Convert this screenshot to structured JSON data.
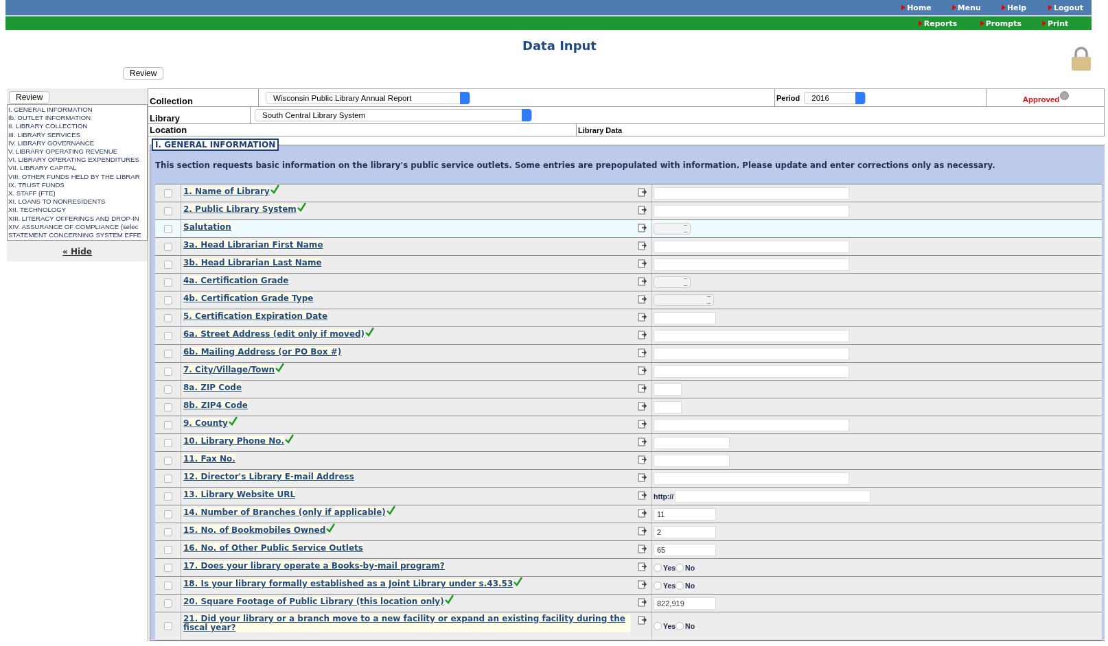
{
  "top_nav": [
    {
      "label": "Home"
    },
    {
      "label": "Menu"
    },
    {
      "label": "Help"
    },
    {
      "label": "Logout"
    }
  ],
  "sub_nav": [
    {
      "label": "Reports"
    },
    {
      "label": "Prompts"
    },
    {
      "label": "Print"
    }
  ],
  "page_title": "Data Input",
  "review_button": "Review",
  "sidebar": {
    "review_button": "Review",
    "items": [
      {
        "label": "I. GENERAL INFORMATION"
      },
      {
        "label": "Ib. OUTLET INFORMATION"
      },
      {
        "label": "II. LIBRARY COLLECTION"
      },
      {
        "label": "III. LIBRARY SERVICES"
      },
      {
        "label": "IV. LIBRARY GOVERNANCE"
      },
      {
        "label": "V. LIBRARY OPERATING REVENUE"
      },
      {
        "label": "VI. LIBRARY OPERATING EXPENDITURES"
      },
      {
        "label": "VII. LIBRARY CAPITAL"
      },
      {
        "label": "VIII. OTHER FUNDS HELD BY THE LIBRAR"
      },
      {
        "label": "IX. TRUST FUNDS"
      },
      {
        "label": "X. STAFF (FTE)"
      },
      {
        "label": "XI. LOANS TO NONRESIDENTS"
      },
      {
        "label": "XII. TECHNOLOGY"
      },
      {
        "label": "XIII. LITERACY OFFERINGS AND DROP-IN"
      },
      {
        "label": "XIV. ASSURANCE OF COMPLIANCE (selec"
      },
      {
        "label": "STATEMENT CONCERNING SYSTEM EFFE"
      }
    ],
    "hide_link": "« Hide"
  },
  "header": {
    "collection_label": "Collection",
    "collection_value": "Wisconsin Public Library Annual Report",
    "period_label": "Period",
    "period_value": "2016",
    "status": "Approved",
    "library_label": "Library",
    "library_value": "South Central Library System",
    "location_label": "Location",
    "library_data_label": "Library Data"
  },
  "section": {
    "title": "I. GENERAL INFORMATION",
    "description": "This section requests basic information on the library's public service outlets. Some entries are prepopulated with information. Please update and enter corrections only as necessary.",
    "rows": [
      {
        "label": "1. Name of Library",
        "verified": true,
        "checked": false,
        "highlighted": false,
        "kind": "long-text"
      },
      {
        "label": "2. Public Library System",
        "verified": true,
        "checked": false,
        "highlighted": false,
        "kind": "long-text"
      },
      {
        "label": "Salutation",
        "verified": false,
        "checked": false,
        "highlighted": true,
        "kind": "select"
      },
      {
        "label": "3a. Head Librarian First Name",
        "verified": false,
        "checked": false,
        "highlighted": false,
        "kind": "long-text"
      },
      {
        "label": "3b. Head Librarian Last Name",
        "verified": false,
        "checked": false,
        "highlighted": false,
        "kind": "long-text"
      },
      {
        "label": "4a. Certification Grade",
        "verified": false,
        "checked": false,
        "highlighted": false,
        "kind": "select"
      },
      {
        "label": "4b. Certification Grade Type",
        "verified": false,
        "checked": false,
        "highlighted": false,
        "kind": "wide-select"
      },
      {
        "label": "5. Certification Expiration Date",
        "verified": false,
        "checked": false,
        "highlighted": false,
        "kind": "short-text"
      },
      {
        "label": "6a. Street Address (edit only if moved)",
        "verified": true,
        "checked": false,
        "highlighted": false,
        "kind": "long-text"
      },
      {
        "label": "6b. Mailing Address (or PO Box #)",
        "verified": false,
        "checked": false,
        "highlighted": false,
        "kind": "long-text"
      },
      {
        "label": "7. City/Village/Town",
        "verified": true,
        "checked": false,
        "highlighted": false,
        "kind": "long-text"
      },
      {
        "label": "8a. ZIP Code",
        "verified": false,
        "checked": false,
        "highlighted": false,
        "kind": "tiny-text"
      },
      {
        "label": "8b. ZIP4 Code",
        "verified": false,
        "checked": false,
        "highlighted": false,
        "kind": "tiny-text"
      },
      {
        "label": "9. County",
        "verified": true,
        "checked": false,
        "highlighted": false,
        "kind": "long-text"
      },
      {
        "label": "10. Library Phone No.",
        "verified": true,
        "checked": false,
        "highlighted": false,
        "kind": "medium-text"
      },
      {
        "label": "11. Fax No.",
        "verified": false,
        "checked": false,
        "highlighted": false,
        "kind": "medium-text"
      },
      {
        "label": "12. Director's Library E-mail Address",
        "verified": false,
        "checked": false,
        "highlighted": false,
        "kind": "long-text"
      },
      {
        "label": "13. Library Website URL",
        "verified": false,
        "checked": false,
        "highlighted": false,
        "kind": "url",
        "prefix": "http://"
      },
      {
        "label": "14. Number of Branches (only if applicable)",
        "verified": true,
        "checked": false,
        "highlighted": false,
        "kind": "short-text",
        "value": "11"
      },
      {
        "label": "15. No. of Bookmobiles Owned",
        "verified": true,
        "checked": false,
        "highlighted": false,
        "kind": "short-text",
        "value": "2"
      },
      {
        "label": "16. No. of Other Public Service Outlets",
        "verified": false,
        "checked": false,
        "highlighted": false,
        "kind": "short-text",
        "value": "65"
      },
      {
        "label": "17. Does your library operate a Books-by-mail program?",
        "verified": false,
        "checked": false,
        "highlighted": false,
        "kind": "yes-no",
        "options": [
          {
            "label": "Yes",
            "selected": false
          },
          {
            "label": "No",
            "selected": false
          }
        ]
      },
      {
        "label": "18. Is your library formally established as a Joint Library under s.43.53",
        "verified": true,
        "checked": false,
        "highlighted": false,
        "kind": "yes-no",
        "options": [
          {
            "label": "Yes",
            "selected": false
          },
          {
            "label": "No",
            "selected": false
          }
        ]
      },
      {
        "label": "20. Square Footage of Public Library (this location only)",
        "verified": true,
        "checked": false,
        "highlighted": false,
        "kind": "short-text",
        "value": "822,919"
      },
      {
        "label": "21. Did your library or a branch move to a new facility or expand an existing facility during the fiscal year?",
        "verified": false,
        "checked": false,
        "highlighted": false,
        "kind": "yes-no",
        "options": [
          {
            "label": "Yes",
            "selected": false
          },
          {
            "label": "No",
            "selected": false
          }
        ]
      }
    ]
  }
}
